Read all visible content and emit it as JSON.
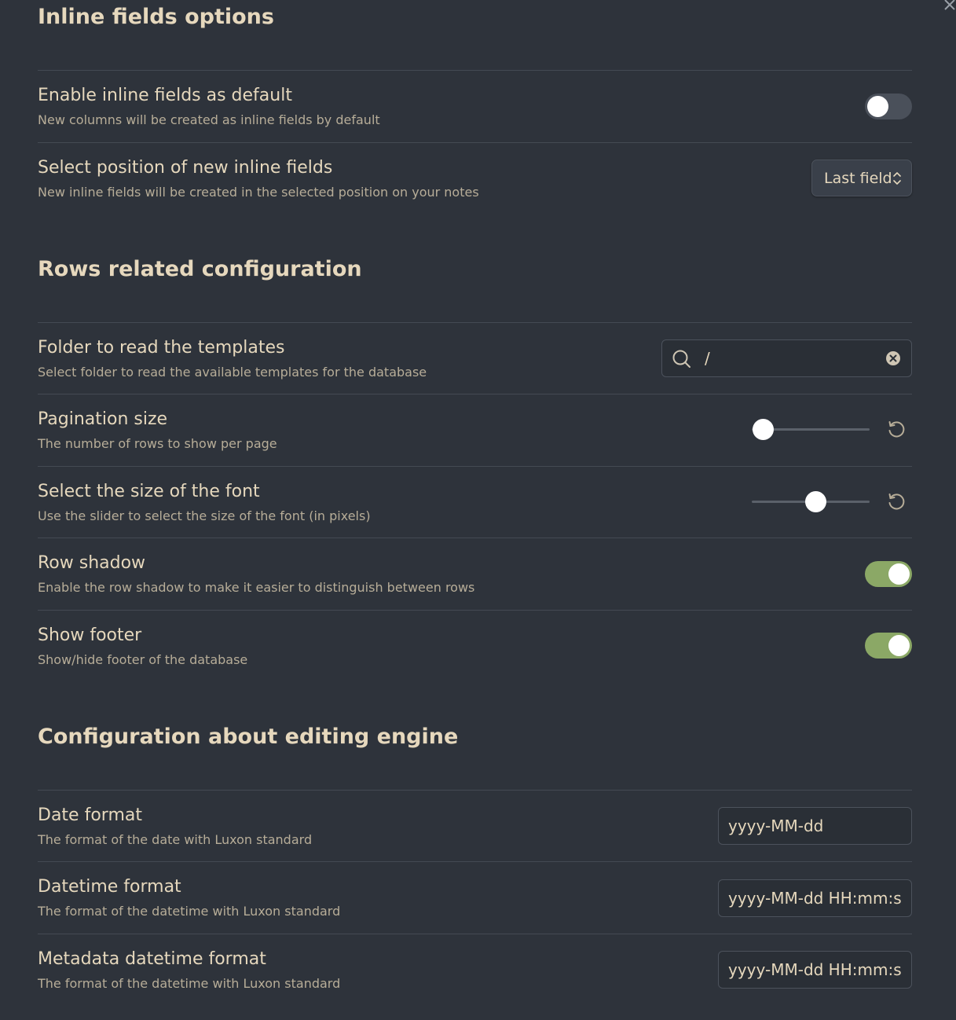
{
  "close_icon": "close-icon",
  "sections": {
    "inline": {
      "title": "Inline fields options",
      "enable_inline": {
        "label": "Enable inline fields as default",
        "desc": "New columns will be created as inline fields by default",
        "on": false
      },
      "position": {
        "label": "Select position of new inline fields",
        "desc": "New inline fields will be created in the selected position on your notes",
        "value": "Last field"
      }
    },
    "rows": {
      "title": "Rows related configuration",
      "templates": {
        "label": "Folder to read the templates",
        "desc": "Select folder to read the available templates for the database",
        "value": "/"
      },
      "pagination": {
        "label": "Pagination size",
        "desc": "The number of rows to show per page",
        "level": 0.09
      },
      "font_size": {
        "label": "Select the size of the font",
        "desc": "Use the slider to select the size of the font (in pixels)",
        "level": 0.54
      },
      "row_shadow": {
        "label": "Row shadow",
        "desc": "Enable the row shadow to make it easier to distinguish between rows",
        "on": true
      },
      "footer": {
        "label": "Show footer",
        "desc": "Show/hide footer of the database",
        "on": true
      }
    },
    "editing": {
      "title": "Configuration about editing engine",
      "date_format": {
        "label": "Date format",
        "desc": "The format of the date with Luxon standard",
        "value": "yyyy-MM-dd"
      },
      "datetime_format": {
        "label": "Datetime format",
        "desc": "The format of the datetime with Luxon standard",
        "value": "yyyy-MM-dd HH:mm:ss"
      },
      "metadata_datetime_format": {
        "label": "Metadata datetime format",
        "desc": "The format of the datetime with Luxon standard",
        "value": "yyyy-MM-dd HH:mm:ss"
      }
    }
  },
  "colors": {
    "background": "#2e333b",
    "text": "#e6d8bd",
    "toggle_on": "#8ba866",
    "toggle_off": "#4a505a"
  }
}
